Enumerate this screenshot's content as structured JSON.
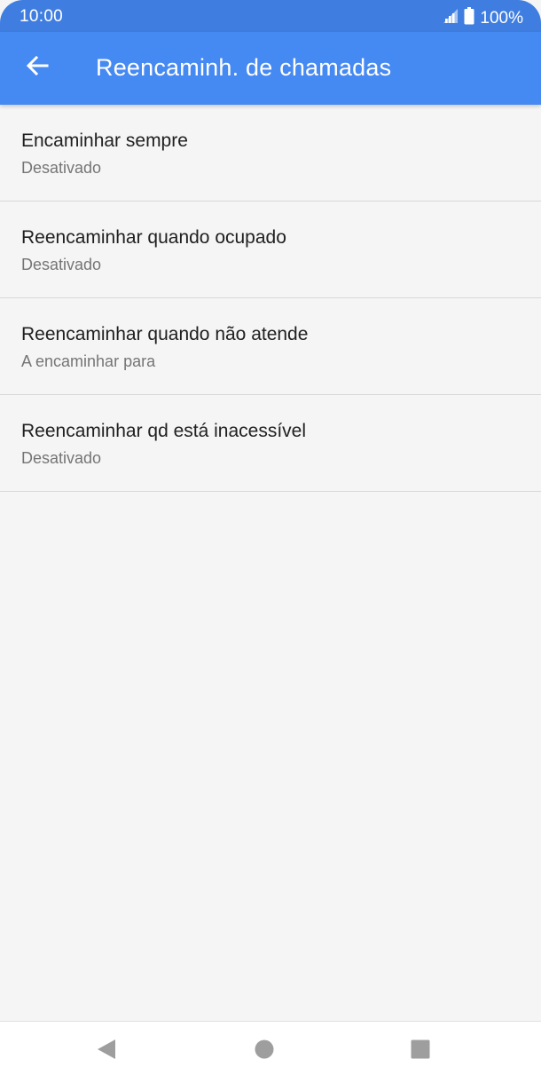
{
  "status_bar": {
    "time": "10:00",
    "battery_text": "100%",
    "signal_icon": "signal-icon",
    "battery_icon": "battery-icon"
  },
  "app_bar": {
    "title": "Reencaminh. de chamadas",
    "back_icon": "arrow-back-icon"
  },
  "list": {
    "items": [
      {
        "title": "Encaminhar sempre",
        "subtitle": "Desativado"
      },
      {
        "title": "Reencaminhar quando ocupado",
        "subtitle": "Desativado"
      },
      {
        "title": "Reencaminhar quando não atende",
        "subtitle": "A encaminhar para"
      },
      {
        "title": "Reencaminhar qd está inacessível",
        "subtitle": "Desativado"
      }
    ]
  },
  "nav_bar": {
    "back_icon": "nav-back-icon",
    "home_icon": "nav-home-icon",
    "recents_icon": "nav-recents-icon"
  },
  "colors": {
    "status_bar": "#3f7ee0",
    "app_bar": "#4589f2",
    "background": "#f5f5f5",
    "divider": "#d8d8d8"
  }
}
